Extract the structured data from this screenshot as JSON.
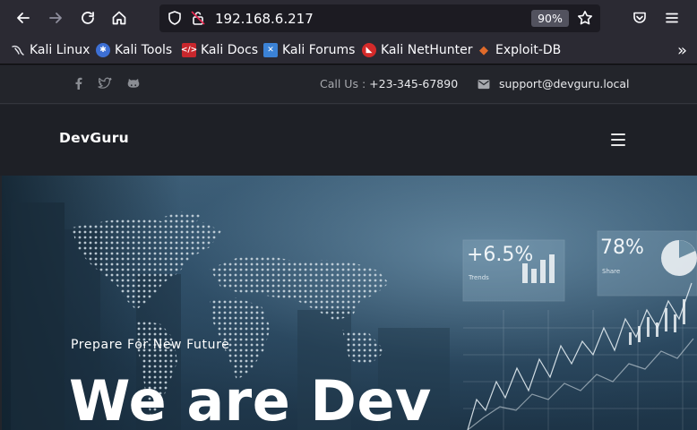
{
  "browser": {
    "url": "192.168.6.217",
    "zoom": "90%",
    "icons": {
      "back": "arrow-left-icon",
      "forward": "arrow-right-icon",
      "reload": "reload-icon",
      "home": "home-icon",
      "shield": "shield-icon",
      "lock": "insecure-lock-icon",
      "star": "star-icon",
      "pocket": "pocket-icon",
      "menu": "hamburger-menu-icon"
    }
  },
  "bookmarks": [
    {
      "label": "Kali Linux",
      "icon": "kali-dragon-icon"
    },
    {
      "label": "Kali Tools",
      "icon": "kali-tools-icon"
    },
    {
      "label": "Kali Docs",
      "icon": "kali-docs-icon"
    },
    {
      "label": "Kali Forums",
      "icon": "kali-forums-icon"
    },
    {
      "label": "Kali NetHunter",
      "icon": "nethunter-icon"
    },
    {
      "label": "Exploit-DB",
      "icon": "exploit-db-icon"
    }
  ],
  "site": {
    "social": [
      "facebook-icon",
      "twitter-icon",
      "github-icon"
    ],
    "call_label": "Call Us :",
    "call_number": "+23-345-67890",
    "email": "support@devguru.local",
    "brand": "DevGuru",
    "hero_subtitle": "Prepare For New Future",
    "hero_title": "We are Dev",
    "stats": {
      "trend": "+6.5%",
      "share": "78%",
      "trend_label": "Trends",
      "share_label": "Share"
    }
  },
  "colors": {
    "browser_chrome": "#2b2a33",
    "page_bg": "#23252b",
    "hero_blue": "#2c4a62"
  }
}
